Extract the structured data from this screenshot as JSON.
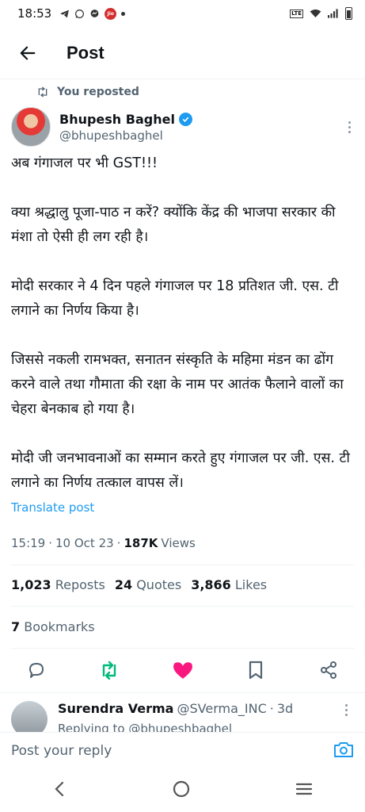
{
  "status_bar": {
    "time": "18:53",
    "carrier_badge": "Jio",
    "network": "LTE"
  },
  "app_bar": {
    "title": "Post"
  },
  "repost_banner": "You reposted",
  "author": {
    "display_name": "Bhupesh Baghel",
    "handle": "@bhupeshbaghel"
  },
  "tweet": {
    "text": "अब गंगाजल पर भी GST!!!\n\nक्या श्रद्धालु पूजा-पाठ न करें? क्योंकि केंद्र की भाजपा सरकार की मंशा तो ऐसी ही लग रही है।\n\nमोदी सरकार ने 4 दिन पहले गंगाजल पर 18 प्रतिशत जी. एस. टी लगाने का निर्णय किया है।\n\nजिससे नकली रामभक्त, सनातन संस्कृति के महिमा मंडन का ढोंग करने वाले तथा गौमाता की रक्षा के नाम पर आतंक फैलाने वालों का चेहरा बेनकाब हो गया है।\n\nमोदी जी जनभावनाओं का सम्मान करते हुए गंगाजल पर जी. एस. टी लगाने का निर्णय तत्काल वापस लें।",
    "translate_label": "Translate post",
    "time": "15:19",
    "date": "10 Oct 23",
    "views_count": "187K",
    "views_label": "Views"
  },
  "stats": {
    "reposts_count": "1,023",
    "reposts_label": "Reposts",
    "quotes_count": "24",
    "quotes_label": "Quotes",
    "likes_count": "3,866",
    "likes_label": "Likes",
    "bookmarks_count": "7",
    "bookmarks_label": "Bookmarks"
  },
  "actions": {
    "icons": [
      "reply-icon",
      "repost-icon",
      "like-icon",
      "bookmark-icon",
      "share-icon"
    ],
    "repost_color": "#00ba7c",
    "like_color": "#f91880"
  },
  "reply": {
    "name": "Surendra Verma",
    "handle": "@SVerma_INC",
    "age": "3d",
    "replying_to": "Replying to @bhupeshbaghel"
  },
  "reply_bar": {
    "placeholder": "Post your reply"
  },
  "colors": {
    "accent": "#1d9bf0",
    "secondary_text": "#536471"
  }
}
